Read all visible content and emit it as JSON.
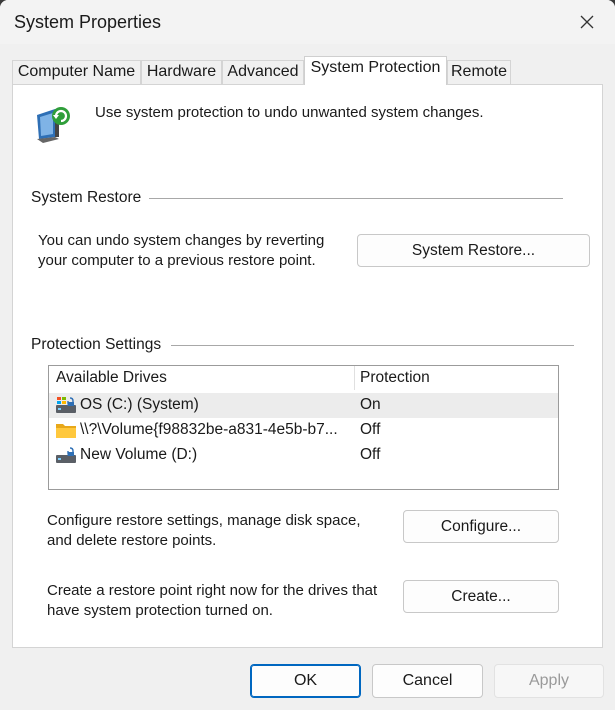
{
  "window": {
    "title": "System Properties"
  },
  "tabs": [
    {
      "label": "Computer Name"
    },
    {
      "label": "Hardware"
    },
    {
      "label": "Advanced"
    },
    {
      "label": "System Protection",
      "active": true
    },
    {
      "label": "Remote"
    }
  ],
  "intro": {
    "text": "Use system protection to undo unwanted system changes.",
    "icon": "system-protection-icon"
  },
  "system_restore": {
    "heading": "System Restore",
    "description_line1": "You can undo system changes by reverting",
    "description_line2": "your computer to a previous restore point.",
    "button_label": "System Restore..."
  },
  "protection": {
    "heading": "Protection Settings",
    "columns": [
      "Available Drives",
      "Protection"
    ],
    "drives": [
      {
        "name": "OS (C:) (System)",
        "protection": "On",
        "icon": "system-drive-icon",
        "selected": true
      },
      {
        "name": "\\\\?\\Volume{f98832be-a831-4e5b-b7...",
        "protection": "Off",
        "icon": "folder-icon"
      },
      {
        "name": "New Volume (D:)",
        "protection": "Off",
        "icon": "drive-icon"
      }
    ]
  },
  "configure": {
    "line1": "Configure restore settings, manage disk space,",
    "line2": "and delete restore points.",
    "button_label": "Configure..."
  },
  "create": {
    "line1": "Create a restore point right now for the drives that",
    "line2": "have system protection turned on.",
    "button_label": "Create..."
  },
  "footer": {
    "ok_label": "OK",
    "cancel_label": "Cancel",
    "apply_label": "Apply"
  },
  "colors": {
    "window_bg": "#f0f0f0",
    "panel_bg": "#ffffff",
    "accent": "#0067c0",
    "disabled_text": "#9a9a9a"
  }
}
